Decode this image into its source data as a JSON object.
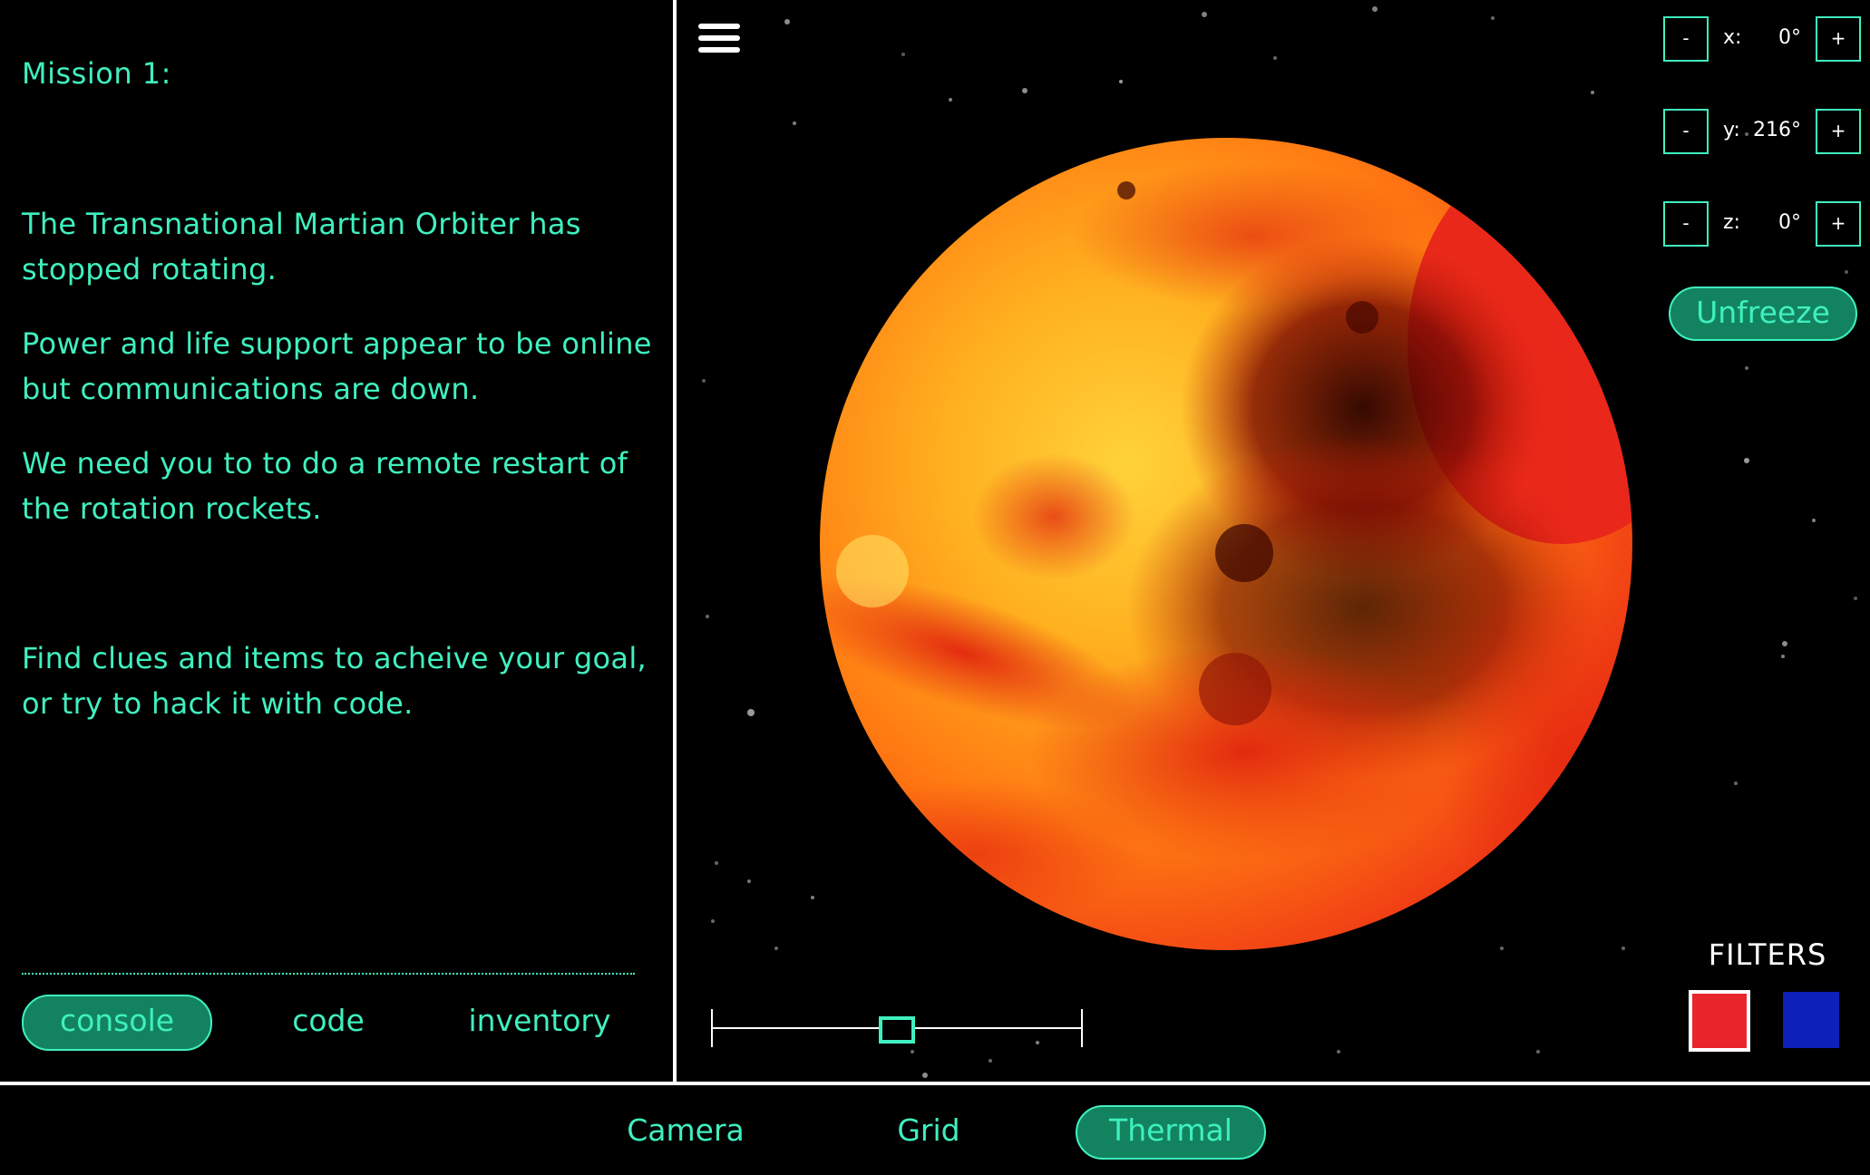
{
  "console": {
    "mission_title": "Mission 1:",
    "paragraphs": [
      "The Transnational Martian Orbiter has stopped rotating.",
      "Power and life support appear to be online but communications are down.",
      "We need you to to do a remote restart of the rotation rockets.",
      "Find clues and items to acheive your goal, or try to hack it with code."
    ],
    "tabs": [
      {
        "label": "console",
        "active": true
      },
      {
        "label": "code",
        "active": false
      },
      {
        "label": "inventory",
        "active": false
      }
    ]
  },
  "viewport": {
    "menu_icon": "hamburger-menu-icon",
    "rotation": {
      "x": {
        "axis": "x:",
        "value": "0°"
      },
      "y": {
        "axis": "y:",
        "value": "216°"
      },
      "z": {
        "axis": "z:",
        "value": "0°"
      },
      "minus_label": "-",
      "plus_label": "+"
    },
    "unfreeze_label": "Unfreeze",
    "filters": {
      "label": "FILTERS",
      "options": [
        {
          "name": "red",
          "color": "#e8262b",
          "selected": true
        },
        {
          "name": "blue",
          "color": "#0d20b8",
          "selected": false
        }
      ]
    },
    "zoom_slider": {
      "value": 0.5
    }
  },
  "view_modes": {
    "tabs": [
      {
        "label": "Camera",
        "active": false
      },
      {
        "label": "Grid",
        "active": false
      },
      {
        "label": "Thermal",
        "active": true
      }
    ]
  },
  "colors": {
    "accent": "#3ff0bf",
    "active_fill": "#13835f",
    "background": "#000000"
  }
}
